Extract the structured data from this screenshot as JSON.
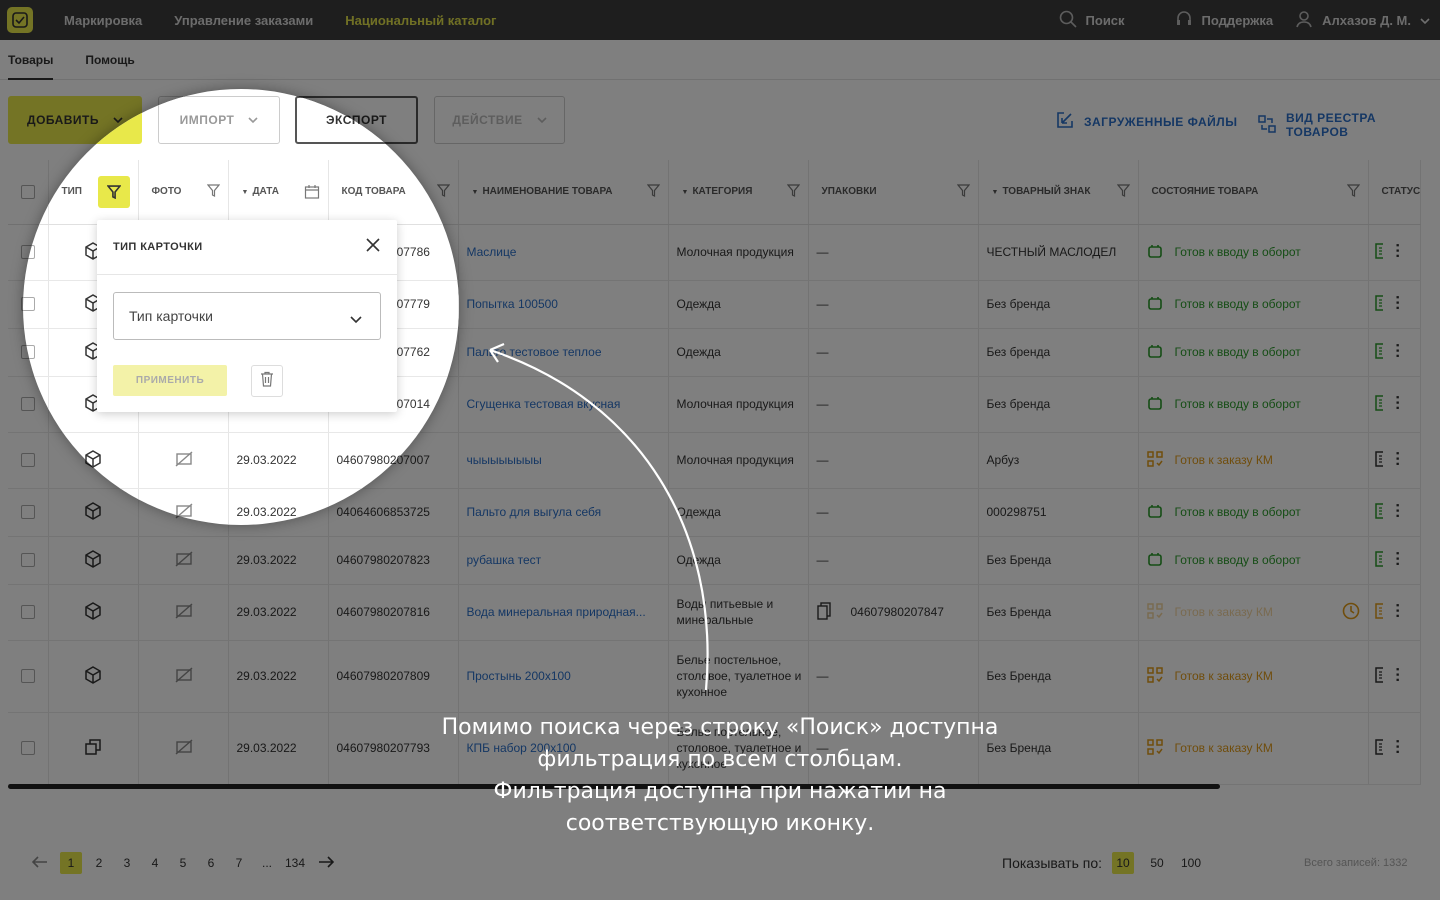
{
  "topbar": {
    "nav": [
      "Маркировка",
      "Управление заказами",
      "Национальный каталог"
    ],
    "active_nav": 2,
    "search_label": "Поиск",
    "support_label": "Поддержка",
    "user_name": "Алхазов Д. М."
  },
  "subtabs": [
    "Товары",
    "Помощь"
  ],
  "toolbar": {
    "add_label": "ДОБАВИТЬ",
    "import_label": "ИМПОРТ",
    "export_label": "ЭКСПОРТ",
    "action_label": "ДЕЙСТВИЕ",
    "uploaded_files_label": "ЗАГРУЖЕННЫЕ ФАЙЛЫ",
    "registry_view_label": "ВИД РЕЕСТРА ТОВАРОВ"
  },
  "table": {
    "headers": [
      "ТИП",
      "ФОТО",
      "ДАТА",
      "КОД ТОВАРА",
      "НАИМЕНОВАНИЕ ТОВАРА",
      "КАТЕГОРИЯ",
      "УПАКОВКИ",
      "ТОВАРНЫЙ ЗНАК",
      "СОСТОЯНИЕ ТОВАРА",
      "СТАТУС"
    ],
    "rows": [
      {
        "date": "29.03.2022",
        "code": "04607980207786",
        "name": "Маслице",
        "category": "Молочная продукция",
        "pack": "—",
        "brand": "ЧЕСТНЫЙ МАСЛОДЕЛ",
        "state": "Готов к вводу в оборот",
        "kind": "green",
        "h": 56
      },
      {
        "date": "29.03.2022",
        "code": "04607980207779",
        "name": "Попытка 100500",
        "category": "Одежда",
        "pack": "—",
        "brand": "Без бренда",
        "state": "Готов к вводу в оборот",
        "kind": "green",
        "h": 48
      },
      {
        "date": "29.03.2022",
        "code": "04607980207762",
        "name": "Пальто тестовое теплое",
        "category": "Одежда",
        "pack": "—",
        "brand": "Без бренда",
        "state": "Готов к вводу в оборот",
        "kind": "green",
        "h": 48
      },
      {
        "date": "29.03.2022",
        "code": "04607980207014",
        "name": "Сгущенка тестовая вкусная",
        "category": "Молочная продукция",
        "pack": "—",
        "brand": "Без бренда",
        "state": "Готов к вводу в оборот",
        "kind": "green",
        "h": 56
      },
      {
        "date": "29.03.2022",
        "code": "04607980207007",
        "name": "чыыыыыыыы",
        "category": "Молочная продукция",
        "pack": "—",
        "brand": "Арбуз",
        "state": "Готов к заказу КМ",
        "kind": "orange",
        "h": 56
      },
      {
        "date": "29.03.2022",
        "code": "04064606853725",
        "name": "Пальто для выгула себя",
        "category": "Одежда",
        "pack": "—",
        "brand": "000298751",
        "state": "Готов к вводу в оборот",
        "kind": "green",
        "h": 48
      },
      {
        "date": "29.03.2022",
        "code": "04607980207823",
        "name": "рубашка тест",
        "category": "Одежда",
        "pack": "—",
        "brand": "Без Бренда",
        "state": "Готов к вводу в оборот",
        "kind": "green",
        "h": 48
      },
      {
        "date": "29.03.2022",
        "code": "04607980207816",
        "name": "Вода минеральная природная...",
        "category": "Воды питьевые и минеральные",
        "pack": "04607980207847",
        "brand": "Без Бренда",
        "state": "Готов к заказу КМ",
        "kind": "faded",
        "h": 56
      },
      {
        "date": "29.03.2022",
        "code": "04607980207809",
        "name": "Простынь 200x100",
        "category": "Белье постельное, столовое, туалетное и кухонное",
        "pack": "—",
        "brand": "Без Бренда",
        "state": "Готов к заказу КМ",
        "kind": "orange",
        "h": 72
      },
      {
        "date": "29.03.2022",
        "code": "04607980207793",
        "name": "КПБ набор 200x100",
        "category": "Белье постельное, столовое, туалетное и кухонное",
        "pack": "—",
        "brand": "Без Бренда",
        "state": "Готов к заказу КМ",
        "kind": "orange",
        "h": 72
      }
    ]
  },
  "pagination": {
    "pages": [
      "1",
      "2",
      "3",
      "4",
      "5",
      "6",
      "7",
      "...",
      "134"
    ],
    "current": "1",
    "show_label": "Показывать по:",
    "sizes": [
      "10",
      "50",
      "100"
    ],
    "current_size": "10",
    "total_label": "Всего записей: 1332"
  },
  "filter_popup": {
    "title": "ТИП КАРТОЧКИ",
    "select_placeholder": "Тип карточки",
    "apply_label": "ПРИМЕНИТЬ"
  },
  "caption": [
    "Помимо поиска через строку «Поиск» доступна",
    "фильтрация по всем столбцам.",
    "Фильтрация доступна при нажатии на",
    "соответствующую иконку."
  ],
  "colors": {
    "accent": "#e8e84a",
    "link": "#2a6fc8",
    "green": "#2a9a2a",
    "orange": "#e09a18",
    "topbar": "#3c3c3c"
  }
}
